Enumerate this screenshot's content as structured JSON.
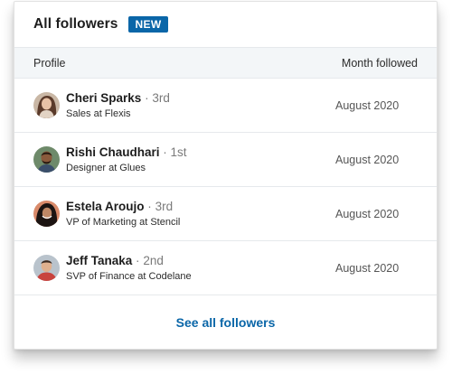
{
  "header": {
    "title": "All followers",
    "badge": "NEW"
  },
  "table": {
    "columns": [
      "Profile",
      "Month followed"
    ],
    "rows": [
      {
        "name": "Cheri Sparks",
        "separator": "·",
        "degree": "3rd",
        "headline": "Sales at Flexis",
        "month": "August 2020"
      },
      {
        "name": "Rishi Chaudhari",
        "separator": "·",
        "degree": "1st",
        "headline": "Designer at Glues",
        "month": "August 2020"
      },
      {
        "name": "Estela Aroujo",
        "separator": "·",
        "degree": "3rd",
        "headline": "VP of Marketing at Stencil",
        "month": "August 2020"
      },
      {
        "name": "Jeff Tanaka",
        "separator": "·",
        "degree": "2nd",
        "headline": "SVP of Finance at Codelane",
        "month": "August 2020"
      }
    ]
  },
  "footer": {
    "link_label": "See all followers"
  },
  "colors": {
    "accent": "#0a66a8",
    "header_band": "#f3f6f8"
  }
}
